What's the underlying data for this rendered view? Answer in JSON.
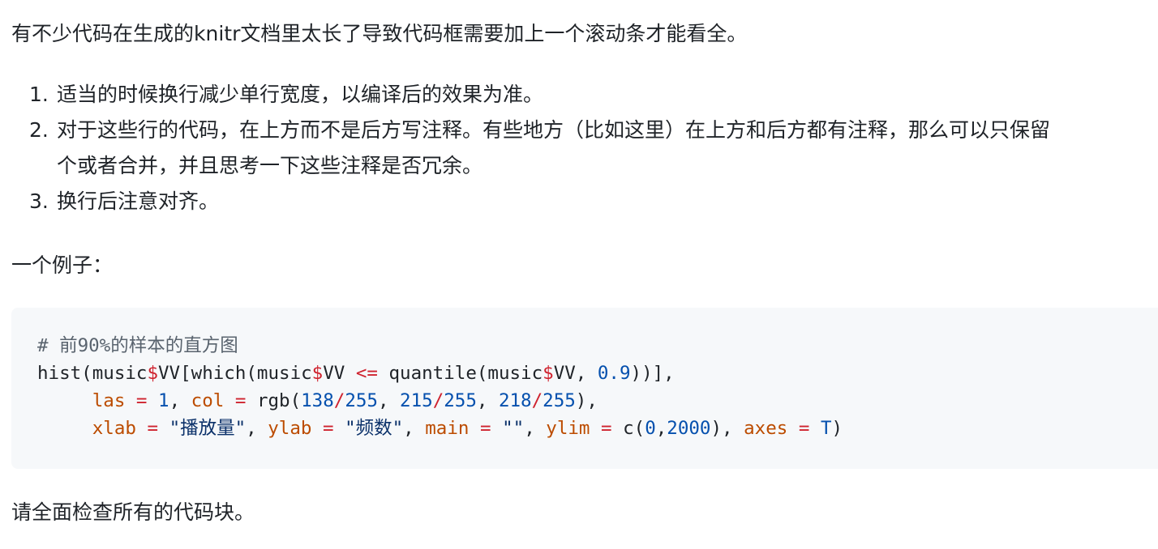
{
  "intro": "有不少代码在生成的knitr文档里太长了导致代码框需要加上一个滚动条才能看全。",
  "list": [
    {
      "num": "1.",
      "text": "适当的时候换行减少单行宽度，以编译后的效果为准。"
    },
    {
      "num": "2.",
      "text": "对于这些行的代码，在上方而不是后方写注释。有些地方（比如这里）在上方和后方都有注释，那么可以只保留",
      "text2": "个或者合并，并且思考一下这些注释是否冗余。"
    },
    {
      "num": "3.",
      "text": "换行后注意对齐。"
    }
  ],
  "example_label": "一个例子：",
  "code": {
    "comment": "# 前90%的样本的直方图",
    "line2": {
      "p1": "hist(music",
      "op1": "$",
      "p2": "VV[which(music",
      "op2": "$",
      "p3": "VV ",
      "op3": "<=",
      "p4": " quantile(music",
      "op4": "$",
      "p5": "VV, ",
      "n1": "0.9",
      "p6": "))],"
    },
    "line3": {
      "indent": "     ",
      "a1": "las",
      "e1": " = ",
      "n1": "1",
      "sep1": ", ",
      "a2": "col",
      "e2": " = ",
      "f1": "rgb(",
      "n2": "138",
      "d1": "/",
      "n3": "255",
      "sep2": ", ",
      "n4": "215",
      "d2": "/",
      "n5": "255",
      "sep3": ", ",
      "n6": "218",
      "d3": "/",
      "n7": "255",
      "end": "),"
    },
    "line4": {
      "indent": "     ",
      "a1": "xlab",
      "e1": " = ",
      "s1": "\"播放量\"",
      "sep1": ", ",
      "a2": "ylab",
      "e2": " = ",
      "s2": "\"频数\"",
      "sep2": ", ",
      "a3": "main",
      "e3": " = ",
      "s3": "\"\"",
      "sep3": ", ",
      "a4": "ylim",
      "e4": " = ",
      "f1": "c(",
      "n1": "0",
      "comma": ",",
      "n2": "2000",
      "sep4": "), ",
      "a5": "axes",
      "e5": " = ",
      "n3": "T",
      "end": ")"
    }
  },
  "closing": "请全面检查所有的代码块。"
}
